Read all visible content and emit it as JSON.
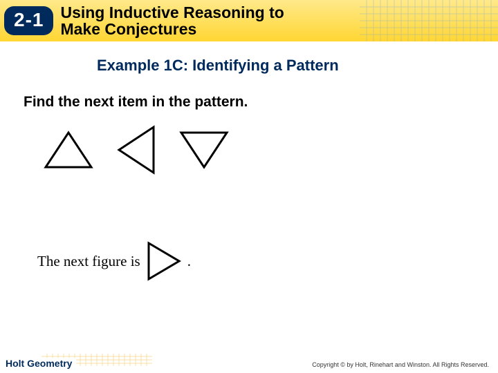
{
  "header": {
    "section_number": "2-1",
    "title_line1": "Using Inductive Reasoning to",
    "title_line2": "Make Conjectures"
  },
  "example": {
    "title": "Example 1C: Identifying a Pattern",
    "instruction": "Find the next item in the pattern."
  },
  "answer": {
    "lead": "The next figure is",
    "period": "."
  },
  "footer": {
    "brand": "Holt Geometry",
    "copyright": "Copyright © by Holt, Rinehart and Winston. All Rights Reserved."
  },
  "triangles": {
    "sequence": [
      "up",
      "left",
      "down"
    ],
    "next": "right"
  }
}
